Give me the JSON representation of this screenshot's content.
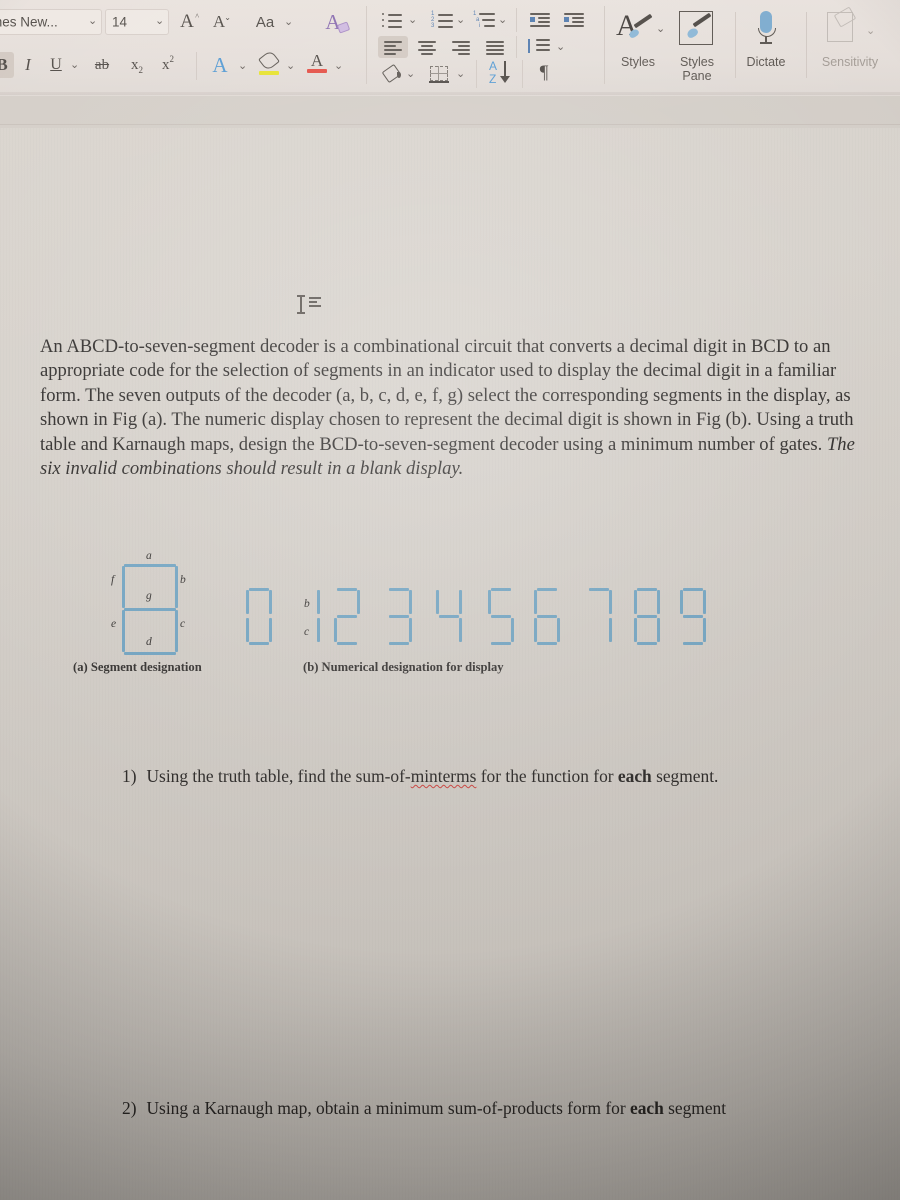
{
  "app": "Microsoft Word",
  "ribbon": {
    "font_name": {
      "value": "mes New...",
      "name": "font-name-combo"
    },
    "font_size": {
      "value": "14",
      "name": "font-size-combo"
    },
    "grow_font": "A",
    "shrink_font": "A",
    "change_case": "Aa",
    "clear_formatting": "A",
    "bold": "B",
    "italic": "I",
    "underline": "U",
    "strikethrough": "ab",
    "subscript": "x",
    "subscript_sub": "2",
    "superscript": "x",
    "superscript_sup": "2",
    "text_effects": "A",
    "highlight": "A",
    "font_color": "A",
    "sort_glyph_top": "A",
    "sort_glyph_bottom": "Z",
    "pilcrow": "¶",
    "styles_label": "Styles",
    "styles_pane_label": "Styles\nPane",
    "dictate_label": "Dictate",
    "sensitivity_label": "Sensitivity",
    "chevron": "⌄"
  },
  "document": {
    "paragraph_runs": [
      {
        "text": "An ABCD-to-seven-segment decoder is a combinational circuit that converts a decimal digit in BCD to an appropriate code for the selection of segments in an indicator used to display the decimal digit in a familiar form. The seven outputs of the decoder (a, b, c, d, e, f, g) select the corresponding segments in the display, as shown in Fig (a). The numeric display chosen to represent the decimal digit is shown in Fig (b). Using a truth table and Karnaugh maps, design the BCD-to-seven-segment decoder using a minimum number of gates. ",
        "italic": false
      },
      {
        "text": "The six invalid combinations should result in a blank display.",
        "italic": true
      }
    ],
    "figure_a": {
      "caption": "(a) Segment designation",
      "segment_labels": {
        "a": "a",
        "b": "b",
        "c": "c",
        "d": "d",
        "e": "e",
        "f": "f",
        "g": "g"
      }
    },
    "figure_b": {
      "caption": "(b) Numerical designation for display",
      "digit_labels_on_one": {
        "b": "b",
        "c": "c"
      },
      "digits": [
        {
          "value": "0",
          "segments": [
            "a",
            "b",
            "c",
            "d",
            "e",
            "f"
          ]
        },
        {
          "value": "1",
          "segments": [
            "b",
            "c"
          ]
        },
        {
          "value": "2",
          "segments": [
            "a",
            "b",
            "g",
            "e",
            "d"
          ]
        },
        {
          "value": "3",
          "segments": [
            "a",
            "b",
            "g",
            "c",
            "d"
          ]
        },
        {
          "value": "4",
          "segments": [
            "f",
            "g",
            "b",
            "c"
          ]
        },
        {
          "value": "5",
          "segments": [
            "a",
            "f",
            "g",
            "c",
            "d"
          ]
        },
        {
          "value": "6",
          "segments": [
            "a",
            "f",
            "g",
            "e",
            "c",
            "d"
          ]
        },
        {
          "value": "7",
          "segments": [
            "a",
            "b",
            "c"
          ]
        },
        {
          "value": "8",
          "segments": [
            "a",
            "b",
            "c",
            "d",
            "e",
            "f",
            "g"
          ]
        },
        {
          "value": "9",
          "segments": [
            "a",
            "b",
            "c",
            "d",
            "f",
            "g"
          ]
        }
      ]
    },
    "questions": [
      {
        "number": "1)",
        "pre": "Using the truth table, find the sum-of-",
        "misspelled": "minterms",
        "mid": " for the function for ",
        "bold": "each",
        "post": " segment."
      },
      {
        "number": "2)",
        "pre": "Using a Karnaugh map, obtain a minimum sum-of-products form for ",
        "misspelled": "",
        "mid": "",
        "bold": "each",
        "post": " segment"
      }
    ]
  },
  "colors": {
    "segment_blue": "#6ea4c4",
    "spellcheck_red": "#d0403c",
    "accent_blue": "#3f6ea8",
    "highlight_yellow": "#e4e017",
    "font_color_red": "#e03a30",
    "toolbar_bg": "#e2dcd8",
    "page_bg": "#d5d0ca"
  }
}
